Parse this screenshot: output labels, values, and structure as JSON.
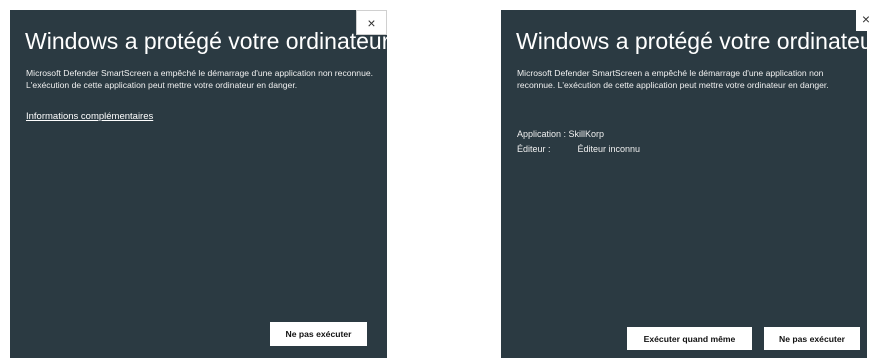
{
  "left_dialog": {
    "close_glyph": "×",
    "title": "Windows a protégé votre ordinateur",
    "description": "Microsoft Defender SmartScreen a empêché le démarrage d'une application non reconnue. L'exécution de cette application peut mettre votre ordinateur en danger.",
    "more_info_link": "Informations complémentaires",
    "dont_run_button": "Ne pas exécuter"
  },
  "right_dialog": {
    "close_glyph": "×",
    "title": "Windows a protégé votre ordinateur",
    "description": "Microsoft Defender SmartScreen a empêché le démarrage d'une application non reconnue. L'exécution de cette application peut mettre votre ordinateur en danger.",
    "application_label": "Application :",
    "application_value": "SkillKorp",
    "publisher_label": "Éditeur :",
    "publisher_value": "Éditeur inconnu",
    "run_anyway_button": "Exécuter quand même",
    "dont_run_button": "Ne pas exécuter"
  },
  "colors": {
    "dialog_background": "#2b3a42",
    "text": "#ffffff",
    "button_background": "#ffffff"
  }
}
